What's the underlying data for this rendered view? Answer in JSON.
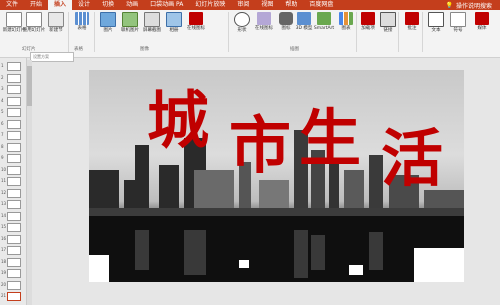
{
  "tabs": [
    "文件",
    "开始",
    "插入",
    "设计",
    "切换",
    "动画",
    "口袋动画 PA",
    "幻灯片放映",
    "审阅",
    "视图",
    "帮助",
    "百度网盘"
  ],
  "active_tab": "插入",
  "tell_me": "操作说明搜索",
  "ribbon_buttons": {
    "new_slide": "新建幻灯片",
    "reuse": "重用幻灯片",
    "add_slide": "新建节",
    "table": "表格",
    "pictures": "图片",
    "screenshot": "屏幕截图",
    "photo_album": "相册",
    "online_pictures": "联机图片",
    "shapes": "形状",
    "icons": "图标",
    "models": "3D 模型",
    "smartart": "SmartArt",
    "chart": "图表",
    "addins": "加载项",
    "link": "链接",
    "comment": "批注",
    "text": "文本",
    "symbols": "符号",
    "media": "媒体",
    "online_slide": "在线图标",
    "online_insert": "在线图标"
  },
  "groups": {
    "slides": "幻灯片",
    "tables": "表格",
    "images": "图像",
    "illustrations": "插图",
    "addins": "加载项",
    "links": "链接",
    "comments": "批注",
    "text": "文本",
    "symbols": "符号",
    "media": "媒体"
  },
  "search_placeholder": "设置方案",
  "slide_numbers": [
    "1",
    "2",
    "3",
    "4",
    "5",
    "6",
    "7",
    "8",
    "9",
    "10",
    "11",
    "12",
    "13",
    "14",
    "15",
    "16",
    "17",
    "18",
    "19",
    "20",
    "21"
  ],
  "slide_title_chars": [
    "城",
    "市",
    "生",
    "活"
  ],
  "colors": {
    "accent": "#c43e1c",
    "title": "#c00000"
  }
}
